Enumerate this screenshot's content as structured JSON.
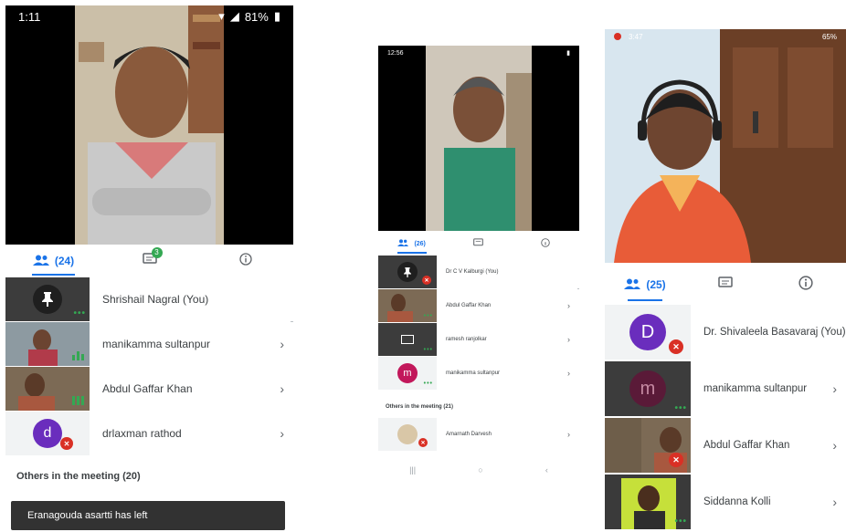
{
  "screen1": {
    "status": {
      "time": "1:11",
      "battery": "81%"
    },
    "tabs": {
      "people": "(24)",
      "chat_badge": "3"
    },
    "participants": [
      {
        "name": "Shrishail Nagral (You)"
      },
      {
        "name": "manikamma sultanpur"
      },
      {
        "name": "Abdul Gaffar Khan"
      },
      {
        "name": "drlaxman rathod",
        "initial": "d"
      }
    ],
    "others": "Others in the meeting (20)",
    "toast": "Eranagouda asartti has left"
  },
  "screen2": {
    "status": {
      "time": "12:56"
    },
    "tabs": {
      "people": "(26)"
    },
    "participants": [
      {
        "name": "Dr C V Kalburgi (You)"
      },
      {
        "name": "Abdul Gaffar Khan"
      },
      {
        "name": "ramesh ranjolkar"
      },
      {
        "name": "manikamma sultanpur",
        "initial": "m"
      }
    ],
    "others": "Others in the meeting (21)",
    "extra": {
      "name": "Amarnath Darvesh"
    }
  },
  "screen3": {
    "status": {
      "time": "3:47",
      "battery": "65%"
    },
    "tabs": {
      "people": "(25)"
    },
    "participants": [
      {
        "name": "Dr. Shivaleela Basavaraj (You)",
        "initial": "D"
      },
      {
        "name": "manikamma sultanpur",
        "initial": "m"
      },
      {
        "name": "Abdul Gaffar Khan"
      },
      {
        "name": "Siddanna Kolli"
      }
    ]
  },
  "icons": {
    "people": "people-icon",
    "chat": "chat-icon",
    "info": "info-icon",
    "chevron": "chevron-right-icon",
    "mic_off": "mic-off-icon",
    "pin": "pin-icon",
    "present": "present-icon"
  },
  "colors": {
    "accent": "#1a73e8",
    "active_green": "#34a853",
    "mic_off_red": "#d93025",
    "avatar_purple": "#6a2dbd",
    "avatar_magenta": "#c2185b"
  }
}
